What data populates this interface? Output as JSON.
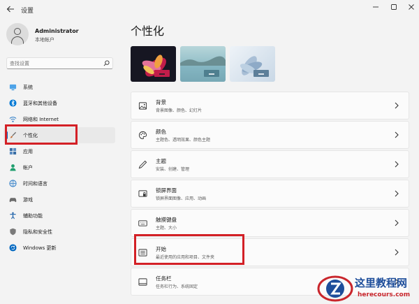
{
  "window": {
    "back_icon": "back-arrow-icon",
    "title": "设置",
    "minimize_icon": "minimize-icon",
    "maximize_icon": "maximize-icon",
    "close_icon": "close-icon"
  },
  "user": {
    "name": "Administrator",
    "account_type": "本地帐户",
    "avatar_icon": "user-avatar-icon"
  },
  "search": {
    "placeholder": "查找设置",
    "icon": "search-icon"
  },
  "sidebar": {
    "items": [
      {
        "label": "系统",
        "icon": "system-icon",
        "icon_color": "#0078d4",
        "selected": false
      },
      {
        "label": "蓝牙和其他设备",
        "icon": "bluetooth-icon",
        "icon_color": "#0078d4",
        "selected": false
      },
      {
        "label": "网络和 Internet",
        "icon": "network-icon",
        "icon_color": "#2b7bc6",
        "selected": false
      },
      {
        "label": "个性化",
        "icon": "brush-icon",
        "icon_color": "#c46b2f",
        "selected": true
      },
      {
        "label": "应用",
        "icon": "apps-icon",
        "icon_color": "#3a6ea5",
        "selected": false
      },
      {
        "label": "帐户",
        "icon": "account-icon",
        "icon_color": "#1f9e6e",
        "selected": false
      },
      {
        "label": "时间和语言",
        "icon": "time-language-icon",
        "icon_color": "#2b7bc6",
        "selected": false
      },
      {
        "label": "游戏",
        "icon": "gaming-icon",
        "icon_color": "#6b6b6b",
        "selected": false
      },
      {
        "label": "辅助功能",
        "icon": "accessibility-icon",
        "icon_color": "#1a5fa8",
        "selected": false
      },
      {
        "label": "隐私和安全性",
        "icon": "shield-icon",
        "icon_color": "#6b6b6b",
        "selected": false
      },
      {
        "label": "Windows 更新",
        "icon": "windows-update-icon",
        "icon_color": "#0067c0",
        "selected": false
      }
    ]
  },
  "main": {
    "title": "个性化",
    "themes": [
      {
        "name": "theme-dark-flower",
        "bg": "#1e1e2a",
        "accent": "#c21d4a"
      },
      {
        "name": "theme-lake",
        "bg": "#9fc7cf",
        "accent": "#4f7f8f"
      },
      {
        "name": "theme-bloom",
        "bg": "#d8e2ee",
        "accent": "#5d7f99"
      }
    ],
    "cards": [
      {
        "title": "背景",
        "desc": "背景图像、颜色、幻灯片",
        "icon": "image-icon"
      },
      {
        "title": "颜色",
        "desc": "主题色、透明效果、颜色主题",
        "icon": "palette-icon"
      },
      {
        "title": "主题",
        "desc": "安装、创建、管理",
        "icon": "pen-icon"
      },
      {
        "title": "锁屏界面",
        "desc": "锁屏界面图像、应用、动画",
        "icon": "lock-screen-icon"
      },
      {
        "title": "触摸键盘",
        "desc": "主题、大小",
        "icon": "keyboard-icon"
      },
      {
        "title": "开始",
        "desc": "最近使用的应用和项目、文件夹",
        "icon": "start-menu-icon"
      },
      {
        "title": "任务栏",
        "desc": "任务栏行为、系统固定",
        "icon": "taskbar-icon"
      }
    ]
  },
  "colors": {
    "accent": "#0067c0",
    "highlight": "#d32026",
    "background": "#f3f3f3",
    "card": "#fbfbfb"
  },
  "watermark": {
    "title": "这里教程网",
    "url": "herecours.com"
  }
}
